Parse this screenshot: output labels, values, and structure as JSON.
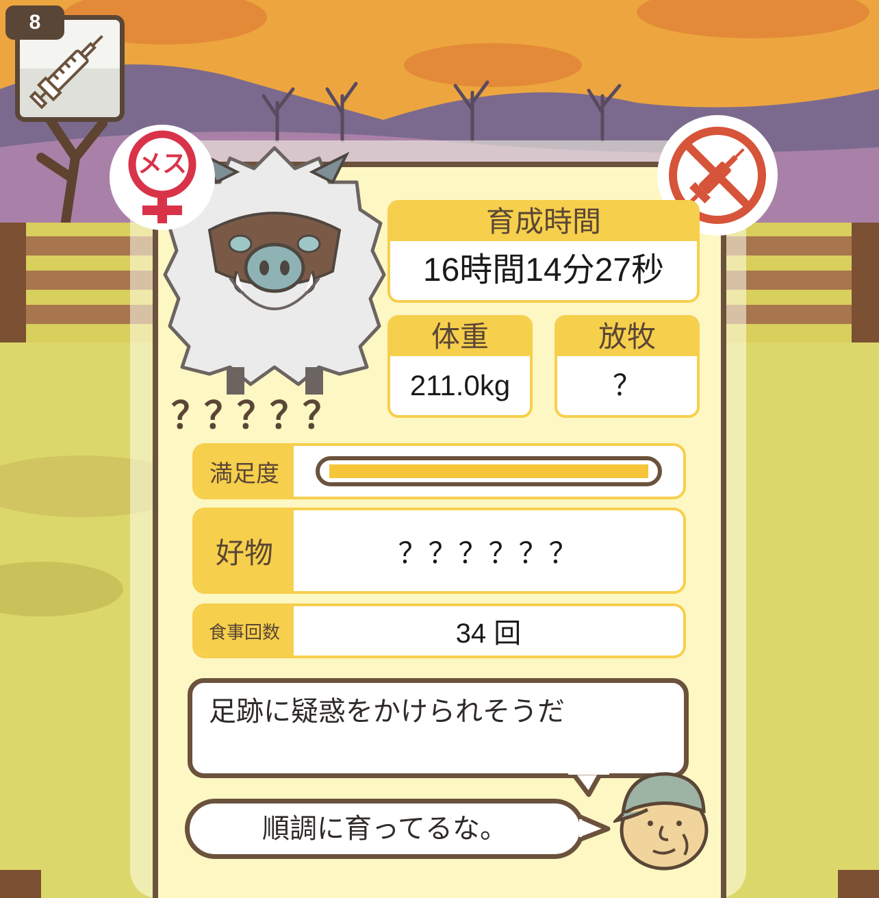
{
  "item": {
    "count": "8",
    "icon": "syringe-icon"
  },
  "badges": {
    "gender_label": "メス",
    "gender_icon": "female-symbol-icon",
    "syringe_status_icon": "no-syringe-icon"
  },
  "animal": {
    "name": "？？？？？",
    "icon": "white-boar-icon"
  },
  "stats": {
    "time": {
      "label": "育成時間",
      "value": "16時間14分27秒"
    },
    "weight": {
      "label": "体重",
      "value": "211.0kg"
    },
    "grazing": {
      "label": "放牧",
      "value": "？"
    },
    "satisfaction": {
      "label": "満足度",
      "level": 1.0
    },
    "favorite": {
      "label": "好物",
      "value": "？？？？？？"
    },
    "meals": {
      "label": "食事回数",
      "value": "34 回"
    }
  },
  "messages": {
    "note": "足跡に疑惑をかけられそうだ",
    "farmer": "順調に育ってるな。",
    "farmer_icon": "farmer-avatar-icon"
  },
  "colors": {
    "accent": "#f6cf4c",
    "frame": "#6b523c",
    "card": "#fdf7c3",
    "female": "#d9334a",
    "warning": "#d6543a"
  }
}
